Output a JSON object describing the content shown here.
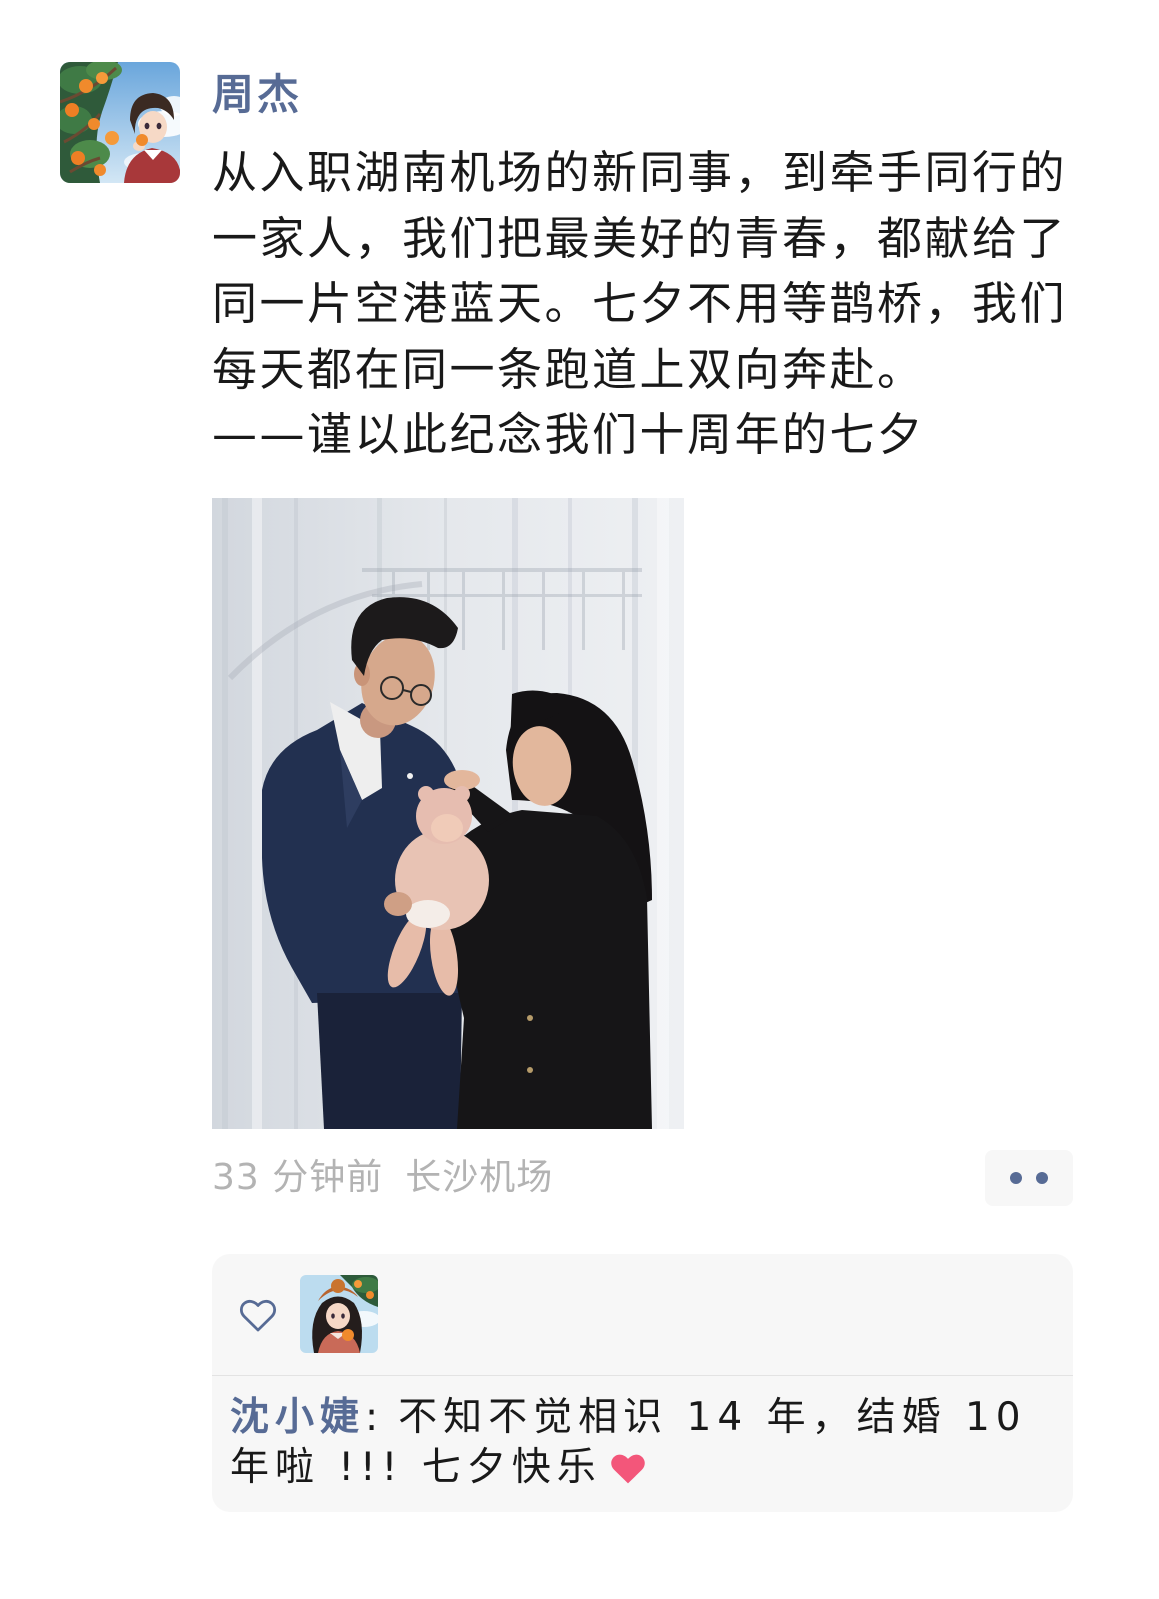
{
  "post": {
    "author": "周杰",
    "avatar_icon": "author-avatar-icon",
    "text_lines": [
      "从入职湖南机场的新同事，到牵手同行的",
      "一家人，我们把最美好的青春，都献给了",
      "同一片空港蓝天。七夕不用等鹊桥，我们",
      "每天都在同一条跑道上双向奔赴。",
      "——谨以此纪念我们十周年的七夕"
    ],
    "time": "33 分钟前",
    "location": "长沙机场",
    "more_icon": "more-dots-icon"
  },
  "interactions": {
    "like_icon": "heart-outline-icon",
    "likers": [
      {
        "avatar_icon": "liker-avatar-icon"
      }
    ],
    "comments": [
      {
        "author": "沈小婕",
        "separator": ":",
        "lines": [
          "不知不觉相识 14 年，结婚 10",
          "年啦 !!! 七夕快乐"
        ],
        "trailing_emoji_icon": "red-heart-icon"
      }
    ]
  },
  "colors": {
    "link": "#576b95",
    "text": "#191919",
    "meta": "#b3b3b3",
    "panel": "#f7f7f7",
    "divider": "#e3e3e3",
    "emoji_heart": "#f3567a"
  }
}
